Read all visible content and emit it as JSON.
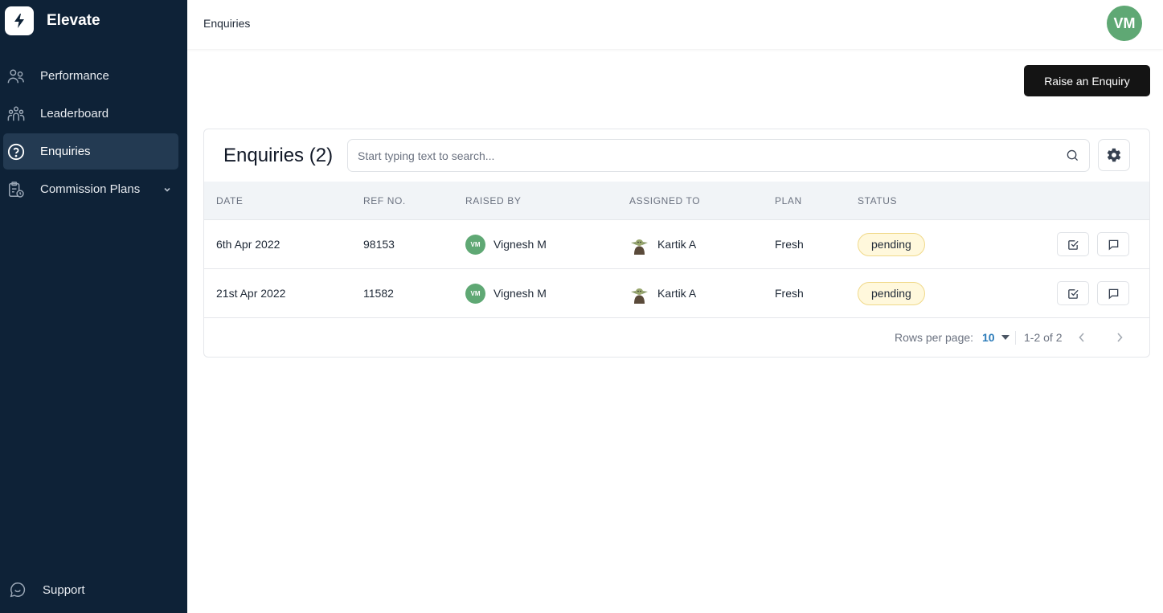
{
  "app": {
    "name": "Elevate"
  },
  "sidebar": {
    "items": [
      {
        "label": "Performance",
        "icon": "users-icon",
        "active": false
      },
      {
        "label": "Leaderboard",
        "icon": "team-icon",
        "active": false
      },
      {
        "label": "Enquiries",
        "icon": "help-circle-icon",
        "active": true
      },
      {
        "label": "Commission Plans",
        "icon": "clipboard-clock-icon",
        "active": false,
        "expandable": true
      }
    ],
    "support_label": "Support"
  },
  "header": {
    "title": "Enquiries",
    "user_initials": "VM"
  },
  "actions": {
    "raise_label": "Raise an Enquiry"
  },
  "enquiries": {
    "title": "Enquiries (2)",
    "search_placeholder": "Start typing text to search...",
    "columns": [
      "DATE",
      "REF NO.",
      "RAISED BY",
      "ASSIGNED TO",
      "PLAN",
      "STATUS"
    ],
    "rows": [
      {
        "date": "6th Apr 2022",
        "ref": "98153",
        "raised_by": "Vignesh M",
        "raised_initials": "VM",
        "assigned_to": "Kartik A",
        "plan": "Fresh",
        "status": "pending"
      },
      {
        "date": "21st Apr 2022",
        "ref": "11582",
        "raised_by": "Vignesh M",
        "raised_initials": "VM",
        "assigned_to": "Kartik A",
        "plan": "Fresh",
        "status": "pending"
      }
    ],
    "pagination": {
      "rows_per_page_label": "Rows per page:",
      "rows_per_page": "10",
      "range": "1-2 of 2"
    }
  },
  "colors": {
    "sidebar_bg": "#0e2237",
    "sidebar_active": "#233a52",
    "avatar_green": "#5fa874",
    "primary_button": "#141414",
    "pending_bg": "#fff8dc",
    "pending_border": "#f0d98a",
    "link_blue": "#2b7bb9"
  }
}
